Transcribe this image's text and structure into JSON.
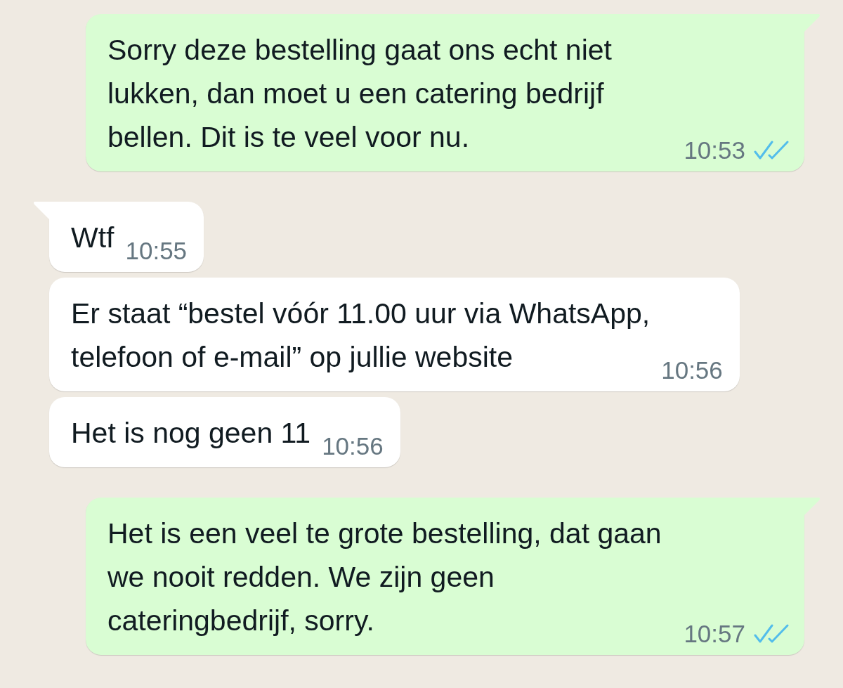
{
  "messages": [
    {
      "kind": "outgoing",
      "tail": true,
      "lines": [
        "Sorry deze bestelling gaat ons echt niet",
        "lukken, dan moet u een catering bedrijf",
        "bellen. Dit is te veel voor nu."
      ],
      "time": "10:53",
      "read": true
    },
    {
      "kind": "incoming",
      "tail": true,
      "lines": [
        "Wtf"
      ],
      "time": "10:55"
    },
    {
      "kind": "incoming",
      "tail": false,
      "lines": [
        "Er staat “bestel vóór 11.00 uur via WhatsApp,",
        "telefoon of e-mail” op jullie website"
      ],
      "time": "10:56"
    },
    {
      "kind": "incoming",
      "tail": false,
      "lines": [
        "Het is nog geen 11"
      ],
      "time": "10:56"
    },
    {
      "kind": "outgoing",
      "tail": true,
      "lines": [
        "Het is een veel te grote bestelling, dat gaan",
        "we nooit redden. We zijn geen",
        "cateringbedrijf, sorry."
      ],
      "time": "10:57",
      "read": true
    }
  ]
}
